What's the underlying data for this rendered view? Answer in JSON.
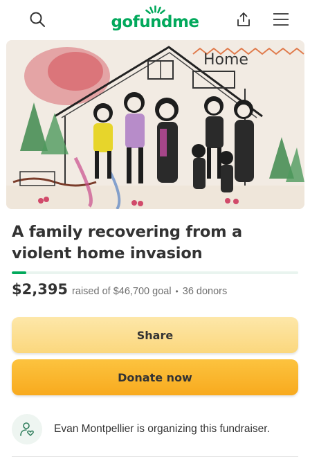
{
  "header": {
    "logo_text": "gofundme",
    "icons": [
      "search-icon",
      "share-upload-icon",
      "menu-icon"
    ],
    "brand_color": "#02a95c"
  },
  "hero": {
    "image_description_icon": "hero-image",
    "drawing_text": "Home"
  },
  "campaign": {
    "title": "A family recovering from a violent home invasion",
    "progress_fraction": 0.05,
    "raised_amount": "$2,395",
    "raised_text": "raised of $46,700 goal",
    "dot": "•",
    "donors_text": "36 donors"
  },
  "actions": {
    "share_label": "Share",
    "donate_label": "Donate now"
  },
  "organizer": {
    "icon": "organizer-heart-icon",
    "text": "Evan Montpellier is organizing this fundraiser."
  }
}
